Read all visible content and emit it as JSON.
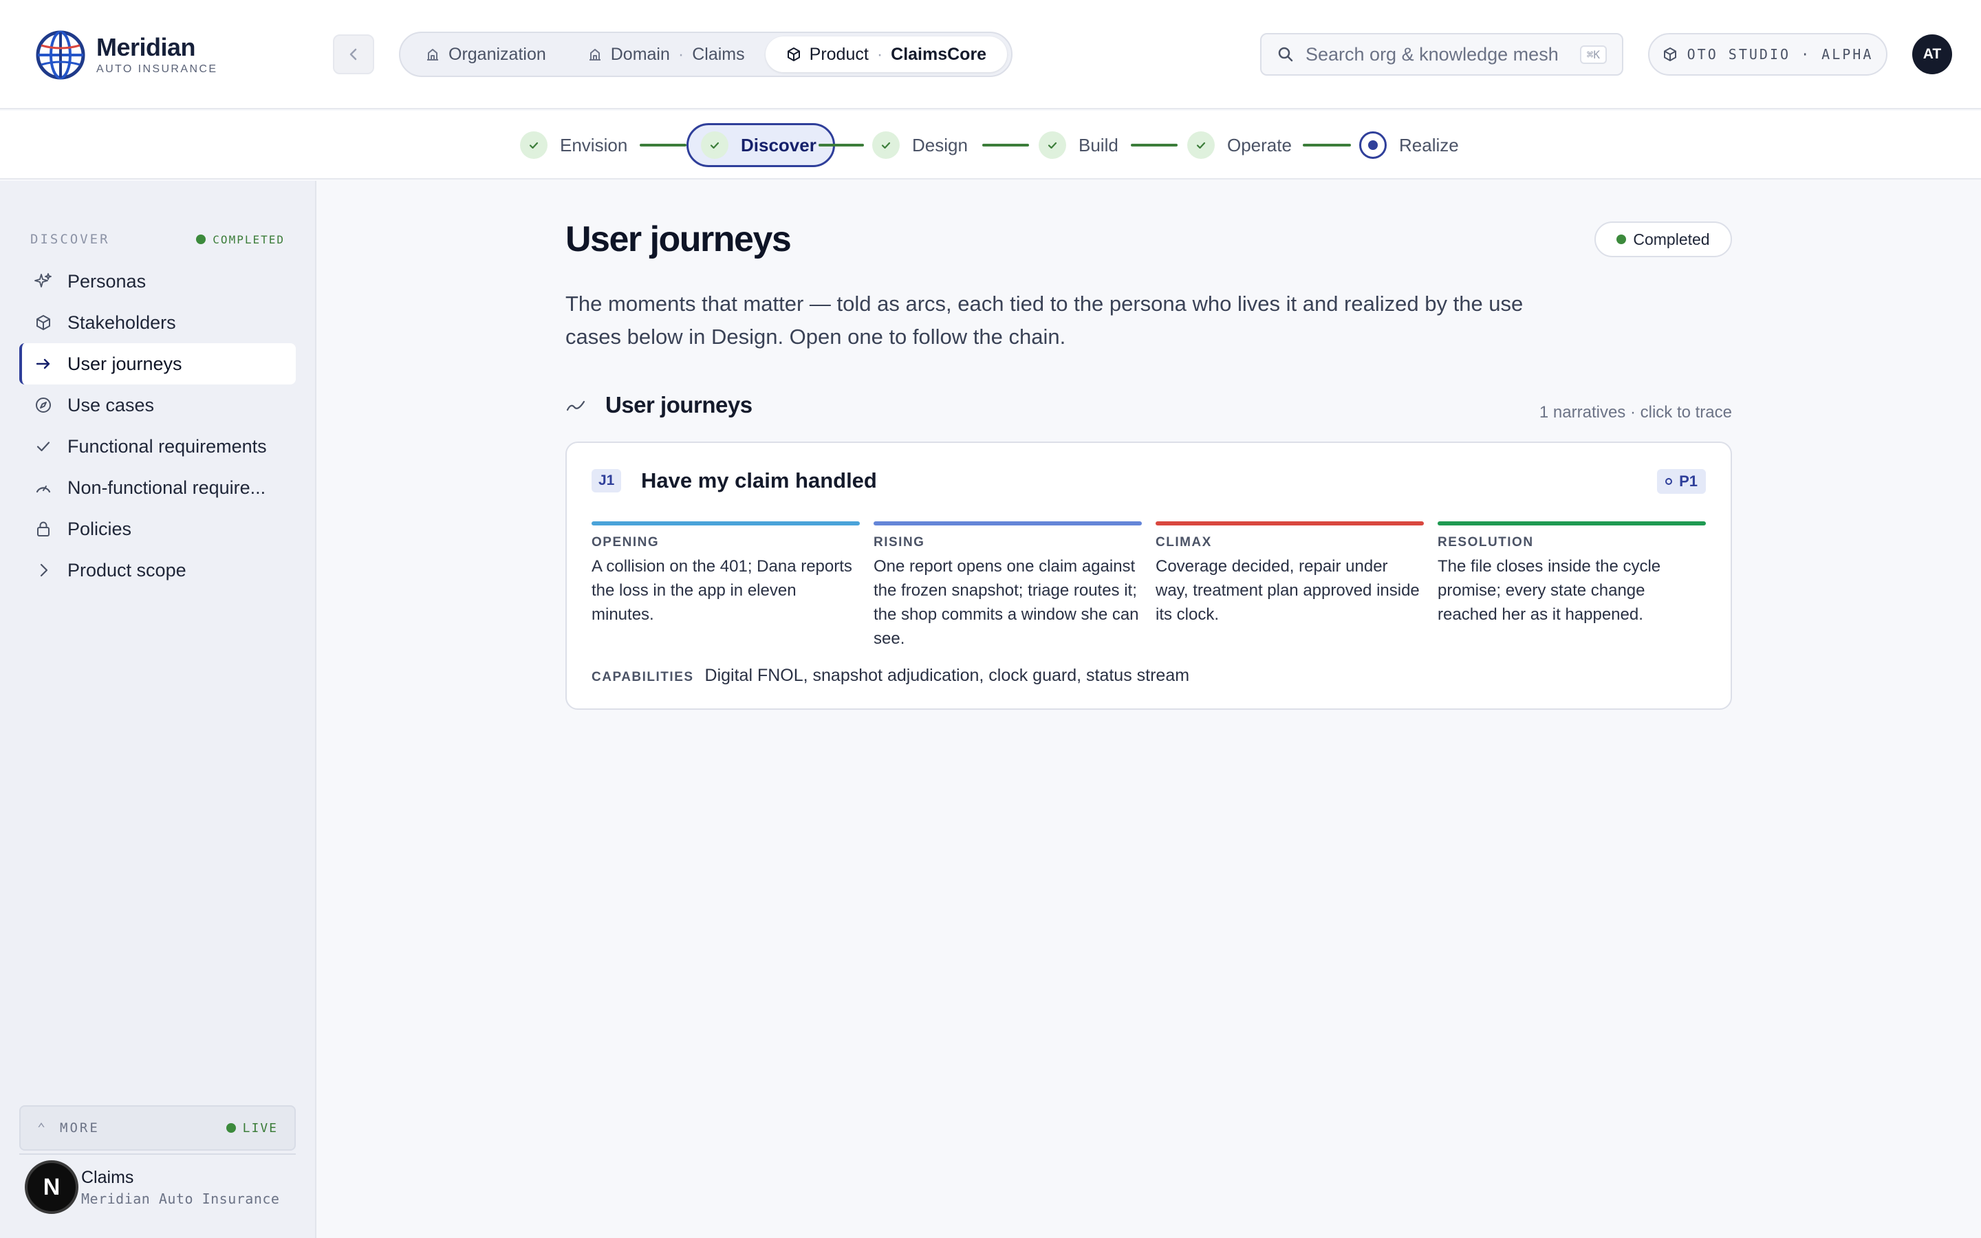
{
  "brand": {
    "name": "Meridian",
    "subtitle": "AUTO INSURANCE"
  },
  "breadcrumbs": [
    {
      "kind": "Organization",
      "value": ""
    },
    {
      "kind": "Domain",
      "value": "Claims"
    },
    {
      "kind": "Product",
      "value": "ClaimsCore"
    }
  ],
  "search": {
    "placeholder": "Search org & knowledge mesh",
    "shortcut": "⌘K"
  },
  "studio_label": "OTO STUDIO · ALPHA",
  "user_initials": "AT",
  "stepper": {
    "steps": [
      {
        "label": "Envision",
        "state": "done"
      },
      {
        "label": "Discover",
        "state": "current"
      },
      {
        "label": "Design",
        "state": "done"
      },
      {
        "label": "Build",
        "state": "done"
      },
      {
        "label": "Operate",
        "state": "done"
      },
      {
        "label": "Realize",
        "state": "active"
      }
    ]
  },
  "sidebar": {
    "section_label": "DISCOVER",
    "section_status": "COMPLETED",
    "items": [
      {
        "label": "Personas",
        "icon": "sparkle-icon"
      },
      {
        "label": "Stakeholders",
        "icon": "cube-icon"
      },
      {
        "label": "User journeys",
        "icon": "arrow-right-icon",
        "active": true
      },
      {
        "label": "Use cases",
        "icon": "compass-icon"
      },
      {
        "label": "Functional requirements",
        "icon": "check-icon"
      },
      {
        "label": "Non-functional require...",
        "icon": "gauge-icon"
      },
      {
        "label": "Policies",
        "icon": "lock-icon"
      },
      {
        "label": "Product scope",
        "icon": "chevron-right-icon"
      }
    ],
    "more_label": "MORE",
    "live_label": "LIVE",
    "tenant": {
      "badge": "N",
      "name": "Claims",
      "org": "Meridian Auto Insurance"
    }
  },
  "main": {
    "title": "User journeys",
    "status": "Completed",
    "lede": "The moments that matter — told as arcs, each tied to the persona who lives it and realized by the use cases below in Design. Open one to follow the chain.",
    "section_title": "User journeys",
    "section_meta": "1 narratives · click to trace",
    "journey": {
      "id": "J1",
      "title": "Have my claim handled",
      "priority": "P1",
      "arcs": [
        {
          "name": "OPENING",
          "color": "#4aa3d9",
          "text": "A collision on the 401; Dana reports the loss in the app in eleven minutes."
        },
        {
          "name": "RISING",
          "color": "#6485d8",
          "text": "One report opens one claim against the frozen snapshot; triage routes it; the shop commits a window she can see."
        },
        {
          "name": "CLIMAX",
          "color": "#d9473f",
          "text": "Coverage decided, repair under way, treatment plan approved inside its clock."
        },
        {
          "name": "RESOLUTION",
          "color": "#1f9a52",
          "text": "The file closes inside the cycle promise; every state change reached her as it happened."
        }
      ],
      "capabilities_label": "CAPABILITIES",
      "capabilities": "Digital FNOL, snapshot adjudication, clock guard, status stream"
    }
  }
}
